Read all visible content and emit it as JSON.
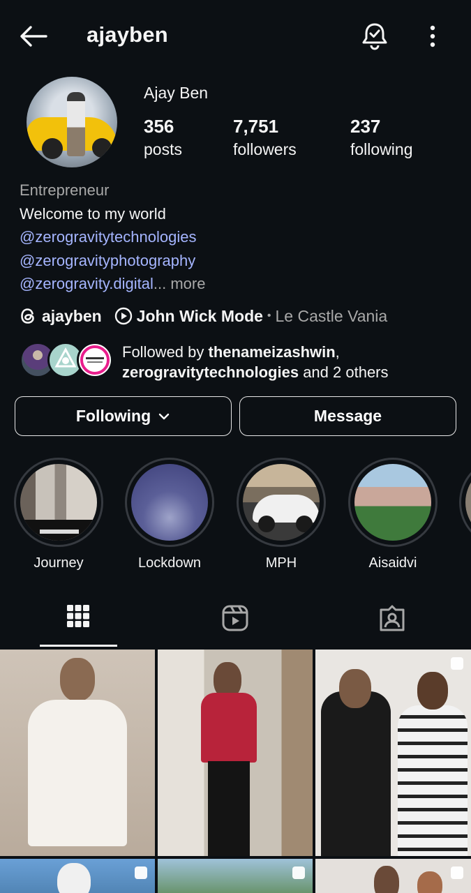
{
  "header": {
    "username": "ajayben",
    "back_icon": "arrow-left-icon",
    "bell_icon": "bell-check-icon",
    "menu_icon": "more-vertical-icon"
  },
  "profile": {
    "full_name": "Ajay Ben",
    "stats": [
      {
        "value": "356",
        "label": "posts"
      },
      {
        "value": "7,751",
        "label": "followers"
      },
      {
        "value": "237",
        "label": "following"
      }
    ]
  },
  "bio": {
    "category": "Entrepreneur",
    "text": "Welcome to my world",
    "links": [
      "@zerogravitytechnologies",
      "@zerogravityphotography",
      "@zerogravity.digital"
    ],
    "truncation": "...",
    "more": " more"
  },
  "meta": {
    "threads_handle": "ajayben",
    "music_title": "John Wick Mode",
    "separator": "•",
    "music_artist": "Le Castle Vania"
  },
  "followed_by": {
    "prefix": "Followed by ",
    "name1": "thenameizashwin",
    "comma": ",",
    "name2": "zerogravitytechnologies",
    "suffix": " and 2 others"
  },
  "buttons": {
    "following": "Following",
    "message": "Message"
  },
  "highlights": [
    {
      "label": "Journey"
    },
    {
      "label": "Lockdown"
    },
    {
      "label": "MPH"
    },
    {
      "label": "Aisaidvi"
    }
  ],
  "tabs": [
    {
      "icon": "grid-icon",
      "active": true
    },
    {
      "icon": "reels-icon",
      "active": false
    },
    {
      "icon": "tagged-icon",
      "active": false
    }
  ],
  "colors": {
    "background": "#0c1014",
    "link": "#a5b5ff",
    "secondary_text": "#a8a8a8"
  }
}
